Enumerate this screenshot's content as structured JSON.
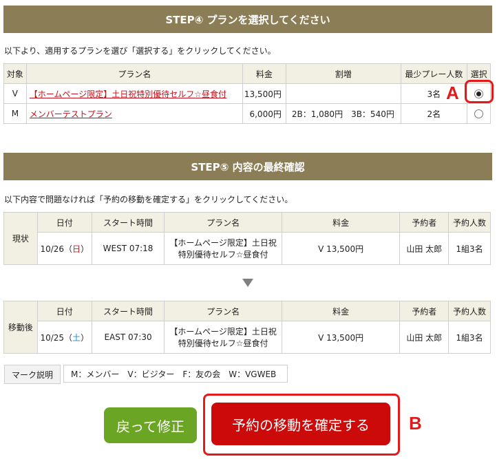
{
  "step4": {
    "title": "STEP④ プランを選択してください",
    "instruction": "以下より、適用するプランを選び「選択する」をクリックしてください。",
    "headers": [
      "対象",
      "プラン名",
      "料金",
      "割増",
      "最少プレー人数",
      "選択"
    ],
    "rows": [
      {
        "target": "V",
        "plan": "【ホームページ限定】土日祝特別優待セルフ☆昼食付",
        "fee": "13,500円",
        "surcharge": "",
        "min_players": "3名",
        "selected": true
      },
      {
        "target": "M",
        "plan": "メンバーテストプラン",
        "fee": "6,000円",
        "surcharge": "2B：1,080円　3B：540円",
        "min_players": "2名",
        "selected": false
      }
    ]
  },
  "step5": {
    "title": "STEP⑤ 内容の最終確認",
    "instruction": "以下内容で問題なければ「予約の移動を確定する」をクリックしてください。",
    "headers": [
      "日付",
      "スタート時間",
      "プラン名",
      "料金",
      "予約者",
      "予約人数"
    ],
    "current": {
      "label": "現状",
      "date_prefix": "10/26（",
      "weekday": "日",
      "date_suffix": "）",
      "start": "WEST 07:18",
      "plan_line1": "【ホームページ限定】土日祝",
      "plan_line2": "特別優待セルフ☆昼食付",
      "fee": "V 13,500円",
      "booker": "山田 太郎",
      "party": "1組3名"
    },
    "after": {
      "label": "移動後",
      "date_prefix": "10/25（",
      "weekday": "土",
      "date_suffix": "）",
      "start": "EAST 07:30",
      "plan_line1": "【ホームページ限定】土日祝",
      "plan_line2": "特別優待セルフ☆昼食付",
      "fee": "V 13,500円",
      "booker": "山田 太郎",
      "party": "1組3名"
    }
  },
  "legend": {
    "label": "マーク説明",
    "text": "M：メンバー　V：ビジター　F：友の会　W：VGWEB"
  },
  "buttons": {
    "back": "戻って修正",
    "confirm": "予約の移動を確定する"
  },
  "annotations": {
    "a": "A",
    "b": "B"
  },
  "colors": {
    "step_bar": "#8b7d55",
    "back_button": "#6aa523",
    "confirm_button": "#cc0a0a",
    "callout": "#e21a1a"
  }
}
